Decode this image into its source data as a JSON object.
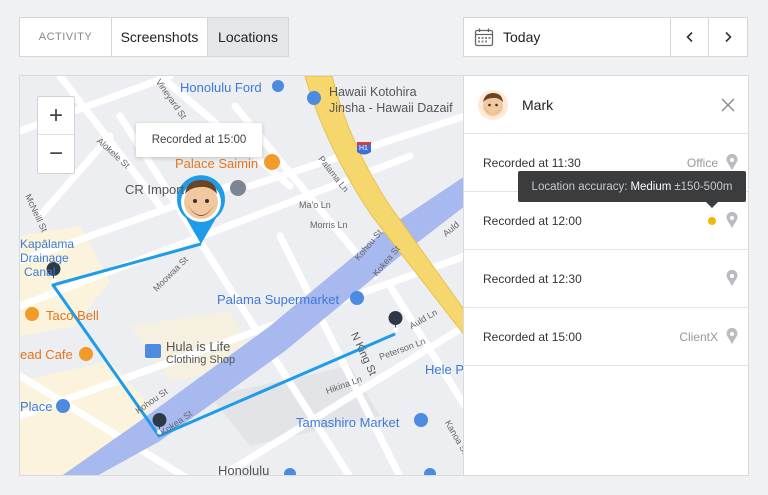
{
  "tabs": [
    {
      "label": "ACTIVITY"
    },
    {
      "label": "Screenshots"
    },
    {
      "label": "Locations"
    }
  ],
  "date": {
    "label": "Today"
  },
  "map": {
    "zoom_in": "+",
    "zoom_out": "−",
    "callout": "Recorded at 15:00",
    "labels": {
      "honolulu_ford": "Honolulu Ford",
      "kotohira_1": "Hawaii Kotohira",
      "kotohira_2": "Jinsha - Hawaii Dazaif",
      "palace_saimin": "Palace Saimin",
      "cr_import": "CR Import",
      "kalama_1": "Kapālama",
      "kalama_2": "Drainage",
      "kalama_3": "Canal",
      "taco_bell": "Taco Bell",
      "lead_cafe": "ead Cafe",
      "hula_1": "Hula is Life",
      "hula_2": "Clothing Shop",
      "palama": "Palama Supermarket",
      "tamashiro": "Tamashiro Market",
      "place": "Place",
      "hele": "Hele P",
      "honolulu": "Honolulu",
      "h1": "H1",
      "s_vineyard": "Vineyard St",
      "s_alokele": "Alokele St",
      "s_palama": "Palama Ln",
      "s_maolo": "Ma'o Ln",
      "s_morris": "Morris Ln",
      "s_kohou": "Kohou St",
      "s_kokea": "Kokea St",
      "s_moowaa": "Moowaa St",
      "s_mcneill": "McNeill St",
      "s_kalihi": "Kalihi St",
      "s_nking": "N King St",
      "s_peterson": "Peterson Ln",
      "s_hikina": "Hikina Ln",
      "s_kohou2": "Kohou St",
      "s_kokea2": "Kokea St",
      "s_aula": "Auld Ln",
      "s_kanoa": "Kanoa St",
      "s_auld2": "Auld"
    }
  },
  "panel": {
    "user": "Mark",
    "rows": [
      {
        "label": "Recorded at 11:30",
        "place": "Office"
      },
      {
        "label": "Recorded at 12:00",
        "place": ""
      },
      {
        "label": "Recorded at 12:30",
        "place": ""
      },
      {
        "label": "Recorded at 15:00",
        "place": "ClientX"
      }
    ]
  },
  "tooltip": {
    "prefix": "Location accuracy:",
    "level": "Medium",
    "range": "±150-500m"
  },
  "colors": {
    "route": "#1e9be9",
    "accuracy_dot": "#f3b705",
    "tab_active_bg": "#e4e6ea",
    "freeway": "#f5d76e",
    "canal": "#9fb3ec"
  }
}
